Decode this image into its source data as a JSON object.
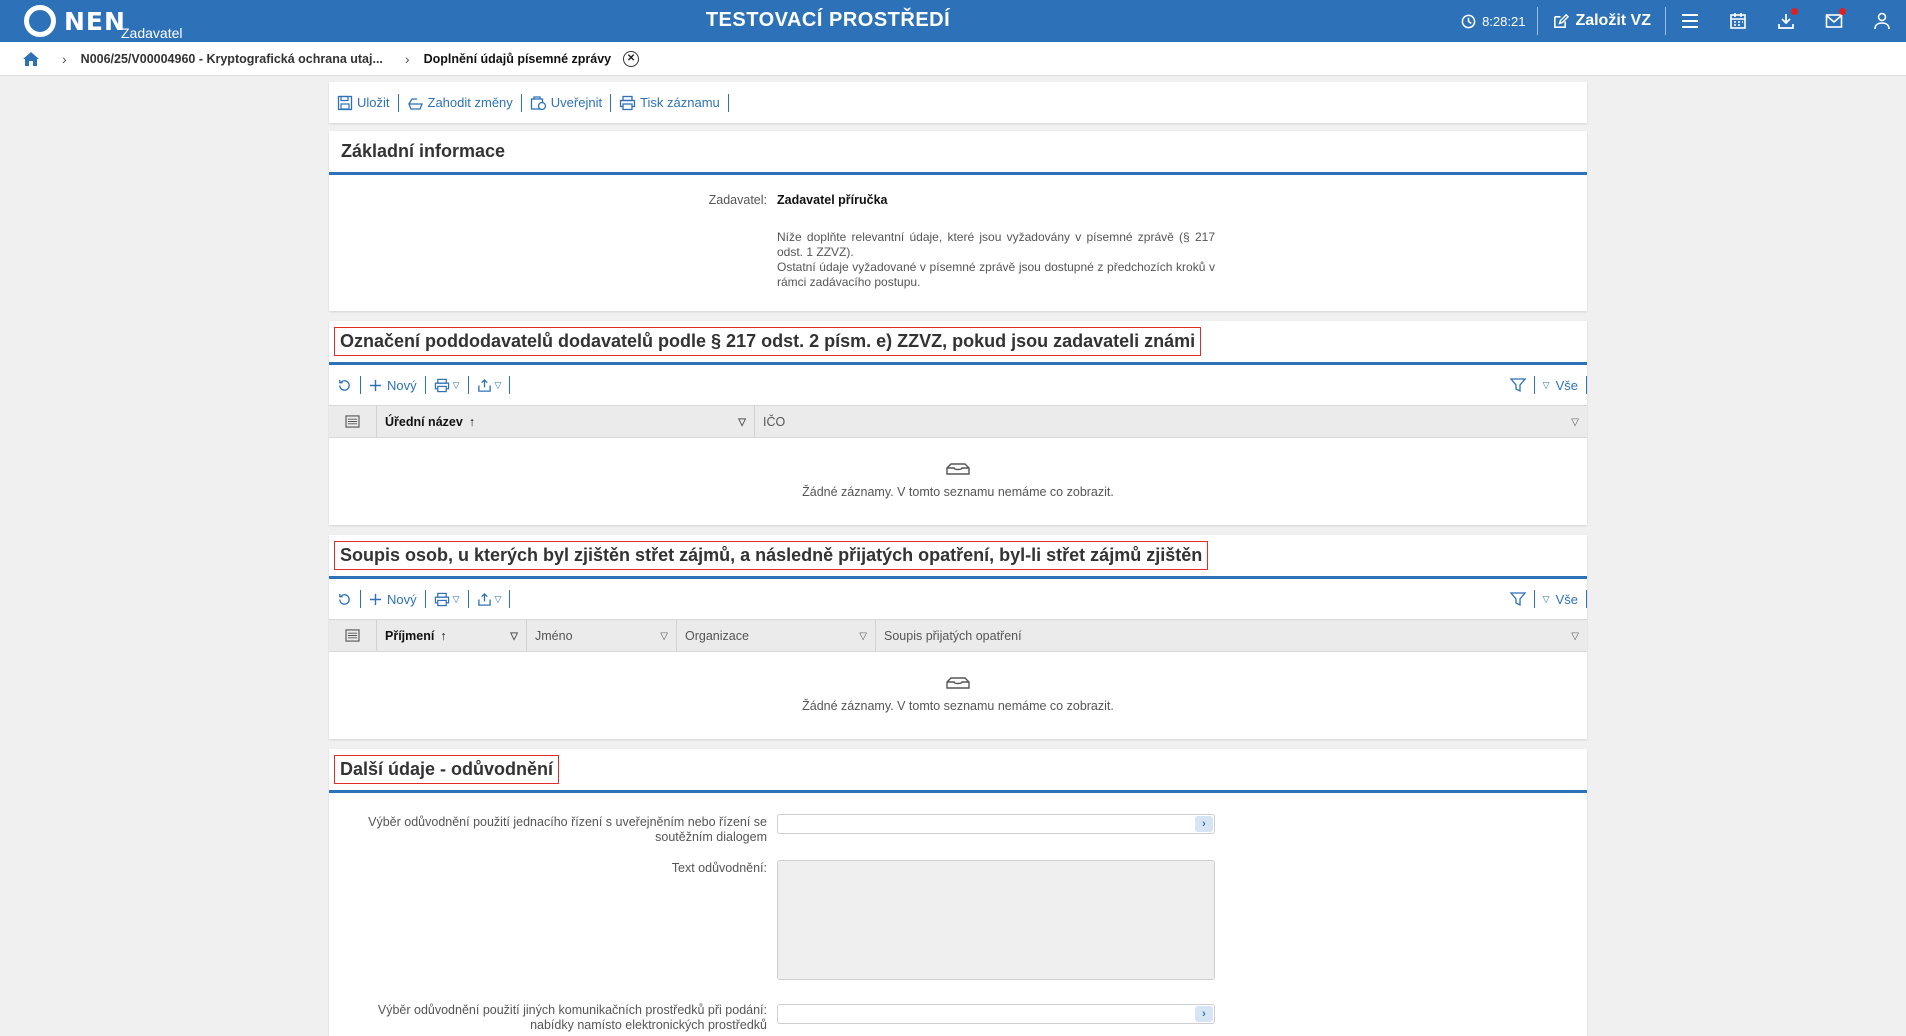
{
  "topbar": {
    "logo_text": "NEN",
    "logo_sub": "Zadavatel",
    "environment": "TESTOVACÍ PROSTŘEDÍ",
    "clock": "8:28:21",
    "new_vz_label": "Založit VZ",
    "color": "#2d72b8"
  },
  "breadcrumb": {
    "item1": "N006/25/V00004960 - Kryptografická ochrana utaj...",
    "current": "Doplnění údajů písemné zprávy"
  },
  "toolbar": {
    "save": "Uložit",
    "discard": "Zahodit změny",
    "publish": "Uveřejnit",
    "print": "Tisk záznamu"
  },
  "basic": {
    "title": "Základní informace",
    "zadavatel_label": "Zadavatel:",
    "zadavatel_value": "Zadavatel příručka",
    "note_line1": "Níže doplňte relevantní údaje, které jsou vyžadovány v písemné zprávě (§ 217 odst. 1 ZZVZ).",
    "note_line2": "Ostatní údaje vyžadované v písemné zprávě jsou dostupné z předchozích kroků v rámci zadávacího postupu."
  },
  "subcontractors": {
    "title": "Označení poddodavatelů dodavatelů podle § 217 odst. 2 písm. e) ZZVZ, pokud jsou zadavateli známi",
    "new_label": "Nový",
    "filter_all": "Vše",
    "columns": [
      "Úřední název",
      "IČO"
    ],
    "empty": "Žádné záznamy. V tomto seznamu nemáme co zobrazit."
  },
  "conflicts": {
    "title": "Soupis osob, u kterých byl zjištěn střet zájmů, a následně přijatých opatření, byl-li střet zájmů zjištěn",
    "new_label": "Nový",
    "filter_all": "Vše",
    "columns": [
      "Příjmení",
      "Jméno",
      "Organizace",
      "Soupis přijatých opatření"
    ],
    "empty": "Žádné záznamy. V tomto seznamu nemáme co zobrazit."
  },
  "justification": {
    "title": "Další údaje - odůvodnění",
    "field1_label": "Výběr odůvodnění použití jednacího řízení s uveřejněním nebo řízení se soutěžním dialogem",
    "field1_label_suffix": ":",
    "field2_label": "Text odůvodnění:",
    "field3_label_l1": "Výběr odůvodnění použití jiných komunikačních prostředků při podání:",
    "field3_label_l2": "nabídky namísto elektronických prostředků"
  }
}
